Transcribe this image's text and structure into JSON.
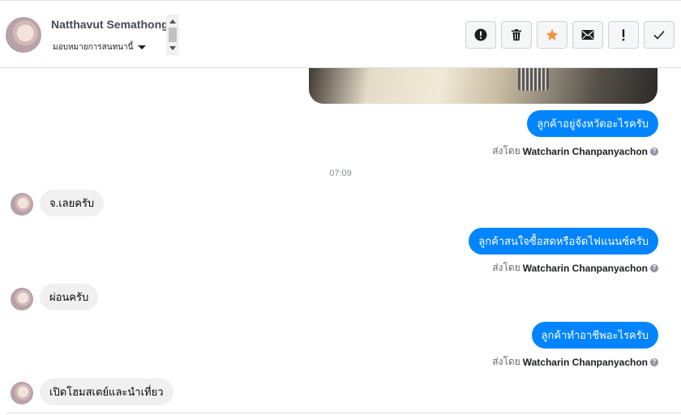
{
  "contact": {
    "name": "Natthavut Semathong",
    "assign_label": "มอบหมายการสนทนานี้"
  },
  "toolbar": {
    "buttons": [
      {
        "icon": "exclamation-circle-icon",
        "label": "Mark as spam"
      },
      {
        "icon": "trash-icon",
        "label": "Delete"
      },
      {
        "icon": "star-icon",
        "label": "Star"
      },
      {
        "icon": "envelope-icon",
        "label": "Mark as unread"
      },
      {
        "icon": "exclamation-icon",
        "label": "Follow up"
      },
      {
        "icon": "checkmark-icon",
        "label": "Done"
      }
    ],
    "star_color": "#f7923b"
  },
  "colors": {
    "outgoing": "#0084ff",
    "incoming": "#f0f0f0"
  },
  "messages": {
    "out1": "ลูกค้าอยู่จังหวัดอะไรครับ",
    "time1": "07:09",
    "in1": "จ.เลยครับ",
    "out2": "ลูกค้าสนใจซื้อสดหรือจัดไฟแนนซ์ครับ",
    "in2": "ผ่อนครับ",
    "out3": "ลูกค้าทำอาชีพอะไรครับ",
    "in3": "เปิดโฮมสเตย์และนำเที่ยว"
  },
  "sent_by": {
    "prefix": "ส่งโดย",
    "agent": "Watcharin Chanpanyachon"
  }
}
